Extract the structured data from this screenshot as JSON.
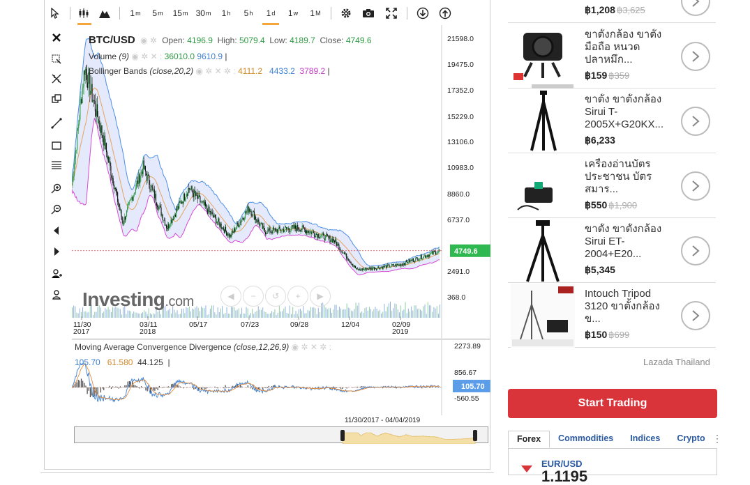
{
  "toolbar": {
    "intervals": [
      {
        "base": "1",
        "sup": "m"
      },
      {
        "base": "5",
        "sup": "m"
      },
      {
        "base": "15",
        "sup": "m"
      },
      {
        "base": "30",
        "sup": "m"
      },
      {
        "base": "1",
        "sup": "h"
      },
      {
        "base": "5",
        "sup": "h"
      },
      {
        "base": "1",
        "sup": "d"
      },
      {
        "base": "1",
        "sup": "w"
      },
      {
        "base": "1",
        "sup": "M"
      }
    ],
    "selected_interval": "1d",
    "icons": [
      "cursor-icon",
      "candlestick-icon",
      "mountain-chart-icon",
      "gear-icon",
      "camera-icon",
      "fullscreen-icon",
      "download-icon",
      "upload-icon"
    ]
  },
  "left_tools": [
    "close-icon",
    "crosshair-delete-icon",
    "measure-icon",
    "copy-icon",
    "trendline-icon",
    "rectangle-icon",
    "fibonacci-icon",
    "zoom-in-icon",
    "zoom-out-icon",
    "scroll-left-icon",
    "scroll-right-icon",
    "magnet-icon",
    "person-icon"
  ],
  "legend": {
    "symbol": "BTC/USD",
    "open_label": "Open:",
    "open": "4196.9",
    "high_label": "High:",
    "high": "5079.4",
    "low_label": "Low:",
    "low": "4189.7",
    "close_label": "Close:",
    "close": "4749.6",
    "volume_label": "Volume",
    "volume_param": "(9)",
    "volume_a": "36010.0",
    "volume_b": "9610.9",
    "bb_label": "Bollinger Bands",
    "bb_param": "(close,20,2)",
    "bb_mid": "4111.2",
    "bb_up": "4433.2",
    "bb_low": "3789.2"
  },
  "main_axis": [
    "21598.0",
    "19475.0",
    "17352.0",
    "15229.0",
    "13106.0",
    "10983.0",
    "8860.0",
    "6737.0",
    "4749.6",
    "2491.0",
    "368.0"
  ],
  "last_price": "4749.6",
  "x_axis": [
    {
      "d": "11/30",
      "y": "2017"
    },
    {
      "d": "03/11",
      "y": "2018"
    },
    {
      "d": "05/17",
      "y": ""
    },
    {
      "d": "07/23",
      "y": ""
    },
    {
      "d": "09/28",
      "y": ""
    },
    {
      "d": "12/04",
      "y": ""
    },
    {
      "d": "02/09",
      "y": "2019"
    }
  ],
  "watermark": {
    "main": "Investing",
    "suffix": ".com"
  },
  "macd": {
    "label": "Moving Average Convergence Divergence",
    "param": "(close,12,26,9)",
    "v1": "105.70",
    "v2": "61.580",
    "v3": "44.125",
    "axis": [
      "2273.89",
      "856.67",
      "105.70",
      "-560.55"
    ],
    "last": "105.70"
  },
  "navigator": {
    "range": "11/30/2017 - 04/04/2019"
  },
  "colors": {
    "accent": "#f4a63b",
    "up": "#2e9a44",
    "band": "#3b7fd4",
    "lower": "#c23cc2",
    "cta": "#d9343a"
  },
  "chart_data": {
    "type": "line",
    "title": "BTC/USD",
    "series": [
      {
        "name": "Close",
        "x": [
          "11/30/2017",
          "12/17/2017",
          "01/10/2018",
          "02/06/2018",
          "03/05/2018",
          "04/06/2018",
          "05/05/2018",
          "06/29/2018",
          "07/24/2018",
          "08/14/2018",
          "09/28/2018",
          "11/14/2018",
          "12/15/2018",
          "02/09/2019",
          "04/04/2019"
        ],
        "values": [
          10000,
          19500,
          14000,
          7000,
          11500,
          6600,
          9800,
          5900,
          8200,
          6300,
          6600,
          5600,
          3200,
          3600,
          4749.6
        ]
      }
    ],
    "ylim": [
      368,
      21598
    ]
  },
  "products": [
    {
      "title": "",
      "price": "฿1,208",
      "old": "฿3,625"
    },
    {
      "title": "ขาตั้งกล้อง ขาตั้ง มือถือ หนวด ปลาหมึก...",
      "price": "฿159",
      "old": "฿359"
    },
    {
      "title": "ขาตั้ง ขาตั้งกล้อง Sirui T-2005X+G20KX...",
      "price": "฿6,233",
      "old": ""
    },
    {
      "title": "เครื่องอ่านบัตร ประชาชน บัตร สมาร...",
      "price": "฿550",
      "old": "฿1,900"
    },
    {
      "title": "ขาตั้ง ขาตั้งกล้อง Sirui ET-2004+E20...",
      "price": "฿5,345",
      "old": ""
    },
    {
      "title": "Intouch Tripod 3120 ขาตั้งกล้อง ข...",
      "price": "฿150",
      "old": "฿699"
    }
  ],
  "ad_source": "Lazada Thailand",
  "cta": "Start Trading",
  "tabs": [
    "Forex",
    "Commodities",
    "Indices",
    "Crypto"
  ],
  "ticker": {
    "pair": "EUR/USD",
    "value": "1.1195"
  }
}
